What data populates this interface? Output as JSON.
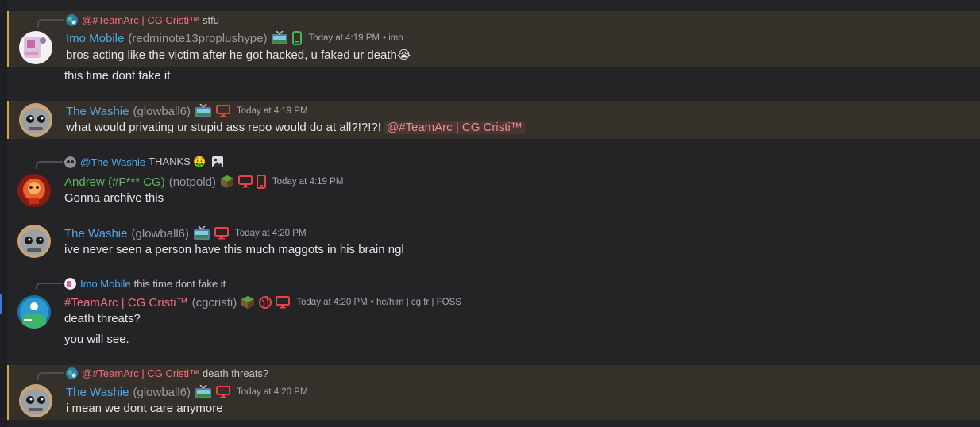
{
  "colors": {
    "highlight_bg": "#35302a",
    "highlight_border": "#d6a544",
    "name_blue": "#4ea8e6",
    "name_green": "#5cb85c",
    "name_red": "#f0707a",
    "mention_bg": "#4a3535"
  },
  "messages": [
    {
      "reply": {
        "name": "@#TeamArc | CG Cristi™",
        "text": "stfu"
      },
      "name": "Imo Mobile",
      "username": "(redminote13proplushype)",
      "timestamp": "Today at 4:19 PM",
      "extra": "• imo",
      "lines": [
        "bros acting like the victim after he got hacked, u faked ur death😭",
        "this time dont fake it"
      ]
    },
    {
      "name": "The Washie",
      "username": "(glowball6)",
      "timestamp": "Today at 4:19 PM",
      "lines": [
        "what would privating ur stupid ass repo would do at all?!?!?!"
      ],
      "mention": "@#TeamArc | CG Cristi™"
    },
    {
      "reply": {
        "name": "@The Washie",
        "text": "THANKS 🤑"
      },
      "name": "Andrew (#F*** CG)",
      "username": "(notpold)",
      "timestamp": "Today at 4:19 PM",
      "lines": [
        "Gonna archive this"
      ]
    },
    {
      "name": "The Washie",
      "username": "(glowball6)",
      "timestamp": "Today at 4:20 PM",
      "lines": [
        "ive never seen a person have this much maggots in his brain ngl"
      ]
    },
    {
      "reply": {
        "name": "Imo Mobile",
        "text": "this time dont fake it"
      },
      "name": "#TeamArc | CG Cristi™",
      "username": "(cgcristi)",
      "timestamp": "Today at 4:20 PM",
      "extra": "• he/him | cg fr | FOSS",
      "lines": [
        "death threats?",
        "you will see."
      ]
    },
    {
      "reply": {
        "name": "@#TeamArc | CG Cristi™",
        "text": "death threats?"
      },
      "name": "The Washie",
      "username": "(glowball6)",
      "timestamp": "Today at 4:20 PM",
      "lines": [
        "i mean we dont care anymore"
      ]
    }
  ]
}
